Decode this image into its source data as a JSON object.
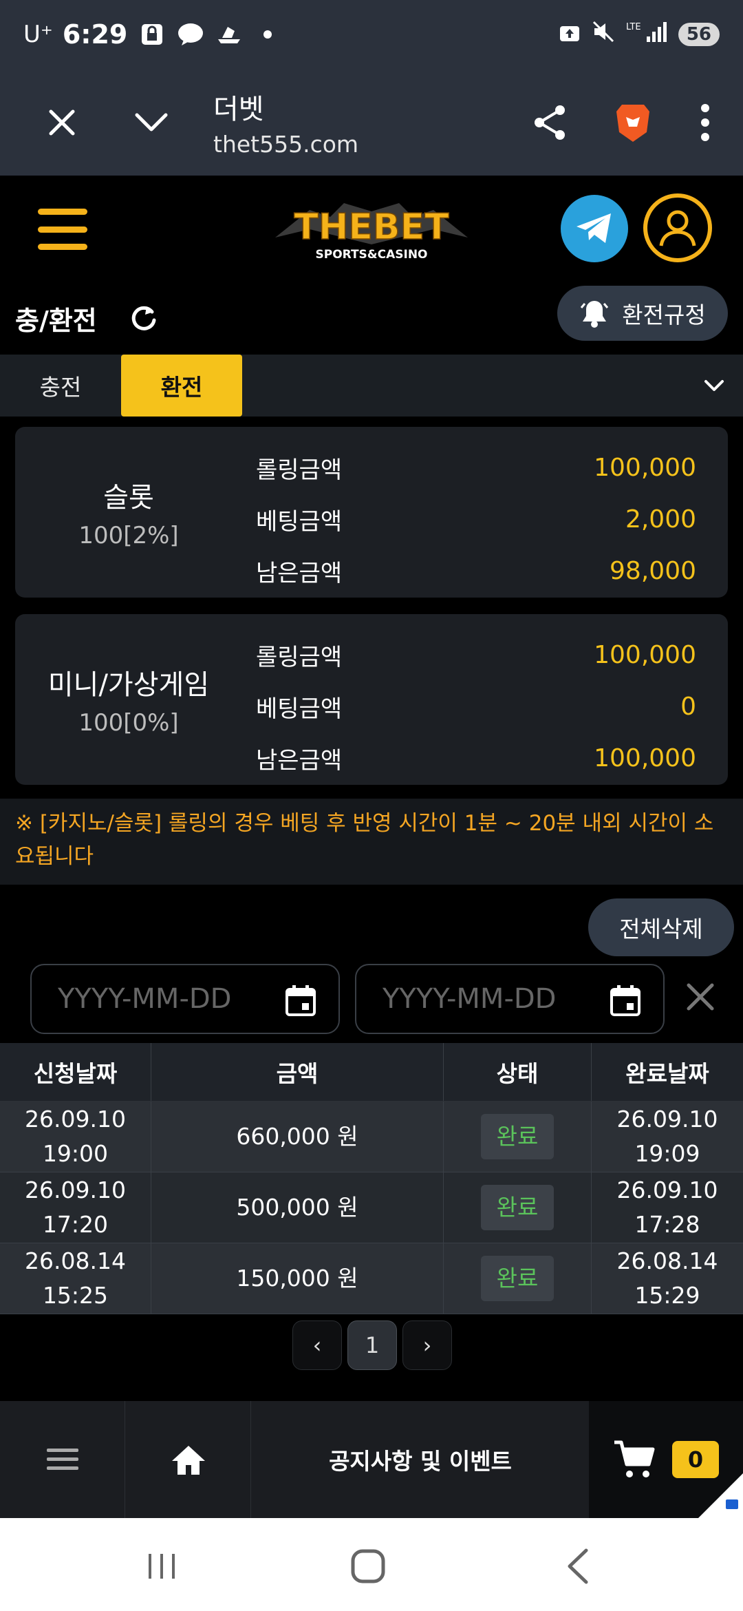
{
  "status_bar": {
    "carrier": "U⁺",
    "time": "6:29",
    "battery": "56"
  },
  "browser": {
    "site_name": "더벳",
    "url": "thet555.com"
  },
  "logo": {
    "main": "THEBET",
    "sub": "SPORTS&CASINO"
  },
  "page": {
    "title": "충/환전",
    "rules_label": "환전규정"
  },
  "tabs": [
    {
      "label": "충전"
    },
    {
      "label": "환전"
    }
  ],
  "rolling": [
    {
      "game": "슬롯",
      "rate": "100[2%]",
      "rows": [
        {
          "label": "롤링금액",
          "value": "100,000"
        },
        {
          "label": "베팅금액",
          "value": "2,000"
        },
        {
          "label": "남은금액",
          "value": "98,000"
        }
      ]
    },
    {
      "game": "미니/가상게임",
      "rate": "100[0%]",
      "rows": [
        {
          "label": "롤링금액",
          "value": "100,000"
        },
        {
          "label": "베팅금액",
          "value": "0"
        },
        {
          "label": "남은금액",
          "value": "100,000"
        }
      ]
    }
  ],
  "notice": "※ [카지노/슬롯] 롤링의 경우 베팅 후 반영 시간이 1분 ~ 20분 내외 시간이 소요됩니다",
  "filters": {
    "delete_all": "전체삭제",
    "start_placeholder": "YYYY-MM-DD",
    "end_placeholder": "YYYY-MM-DD"
  },
  "table": {
    "headers": [
      "신청날짜",
      "금액",
      "상태",
      "완료날짜"
    ],
    "rows": [
      {
        "req_date": "26.09.10",
        "req_time": "19:00",
        "amount": "660,000 원",
        "status": "완료",
        "done_date": "26.09.10",
        "done_time": "19:09"
      },
      {
        "req_date": "26.09.10",
        "req_time": "17:20",
        "amount": "500,000 원",
        "status": "완료",
        "done_date": "26.09.10",
        "done_time": "17:28"
      },
      {
        "req_date": "26.08.14",
        "req_time": "15:25",
        "amount": "150,000 원",
        "status": "완료",
        "done_date": "26.08.14",
        "done_time": "15:29"
      }
    ]
  },
  "pagination": {
    "prev": "‹",
    "current": "1",
    "next": "›"
  },
  "bottom_nav": {
    "notice_label": "공지사항 및 이벤트",
    "cart_count": "0"
  },
  "colors": {
    "accent": "#f5c21b",
    "header_bg": "#2b313c",
    "status_done": "#5bc35b",
    "telegram": "#2aa1dc"
  }
}
